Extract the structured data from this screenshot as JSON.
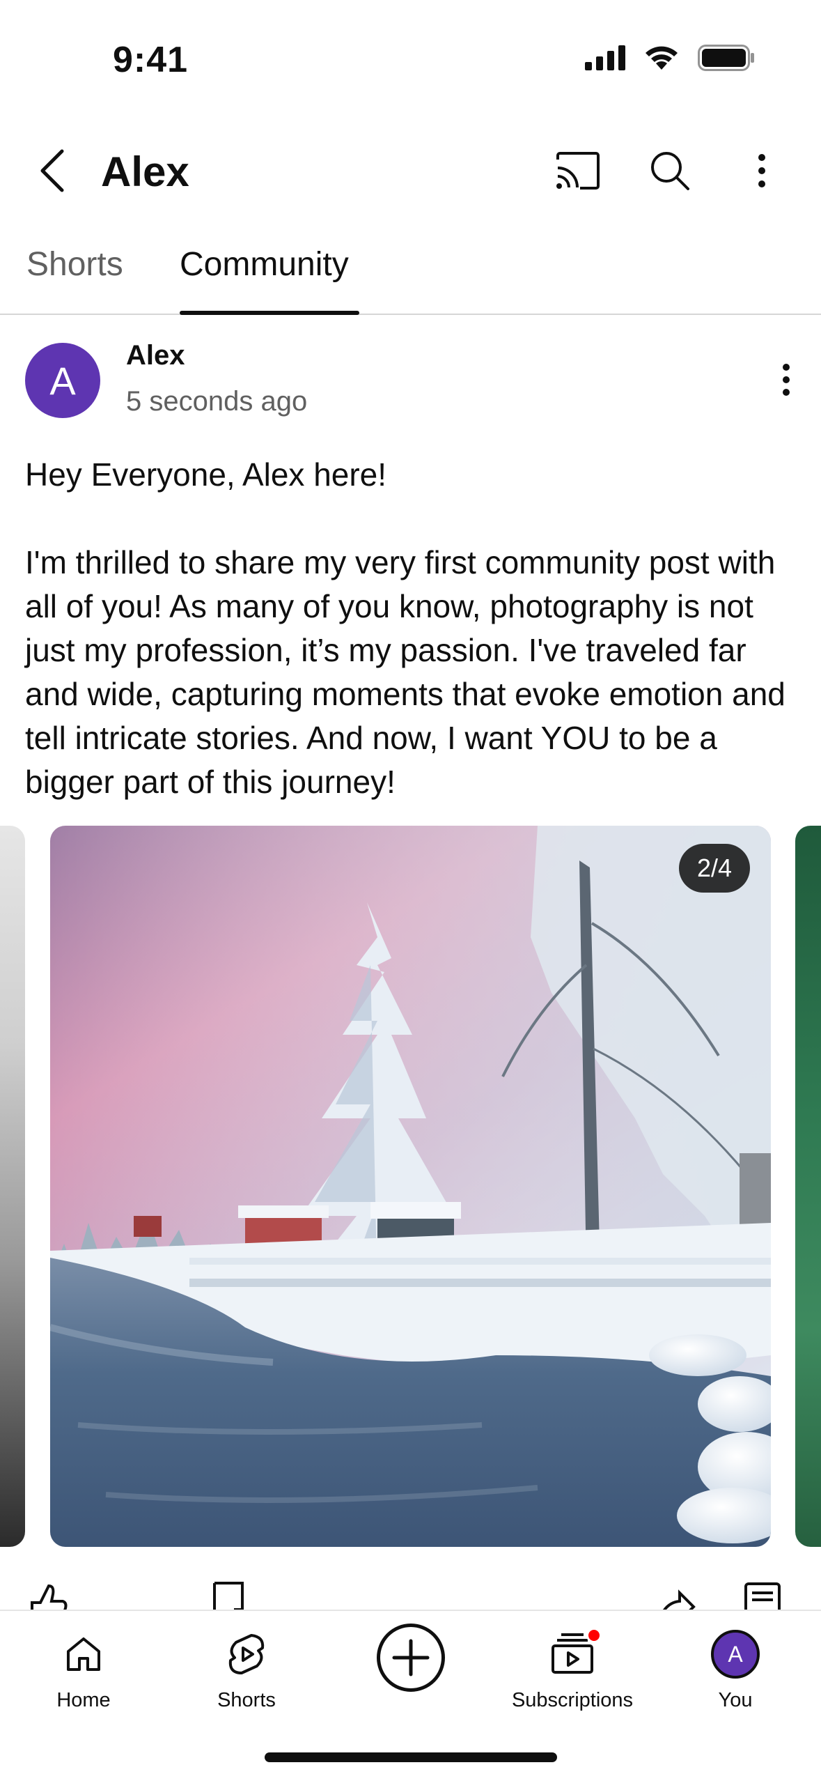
{
  "status_bar": {
    "time": "9:41"
  },
  "header": {
    "title": "Alex"
  },
  "tabs": [
    {
      "label": "Shorts",
      "active": false
    },
    {
      "label": "Community",
      "active": true
    }
  ],
  "post": {
    "author": "Alex",
    "avatar_initial": "A",
    "timestamp": "5 seconds ago",
    "paragraphs": [
      "Hey Everyone, Alex here!",
      "I'm thrilled to share my very first community post with all of you! As many of you know, photography is not just my profession, it’s my passion. I've traveled far and wide, capturing moments that evoke emotion and tell intricate stories. And now, I want YOU to be a bigger part of this journey!"
    ],
    "carousel": {
      "counter": "2/4",
      "current": 2,
      "total": 4
    }
  },
  "bottom_nav": {
    "items": [
      {
        "label": "Home",
        "icon": "home-icon"
      },
      {
        "label": "Shorts",
        "icon": "shorts-icon"
      },
      {
        "label": "",
        "icon": "create-icon"
      },
      {
        "label": "Subscriptions",
        "icon": "subscriptions-icon"
      },
      {
        "label": "You",
        "icon": "avatar"
      }
    ],
    "you_initial": "A"
  },
  "colors": {
    "avatar_bg": "#5e35b1",
    "notification_dot": "#ff0000",
    "text_primary": "#0f0f0f",
    "text_secondary": "#606060"
  }
}
